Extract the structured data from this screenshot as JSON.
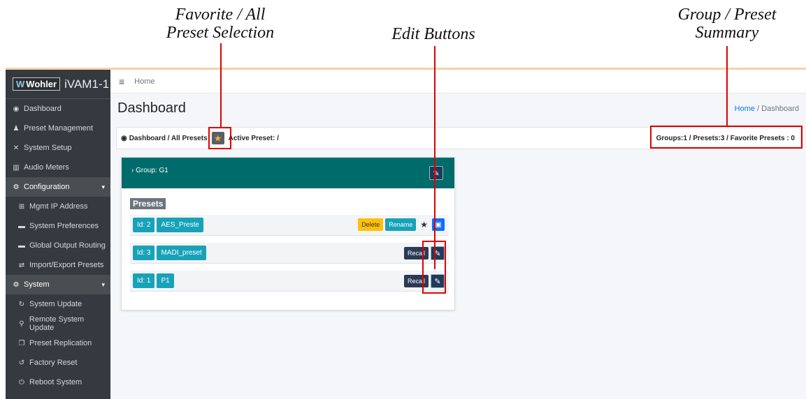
{
  "annotations": {
    "favorite_selection_line1": "Favorite / All",
    "favorite_selection_line2": "Preset Selection",
    "edit_buttons": "Edit Buttons",
    "summary_line1": "Group / Preset",
    "summary_line2": "Summary"
  },
  "brand": {
    "logo_text": "Wohler",
    "device": "iVAM1-1"
  },
  "sidebar": {
    "items": [
      {
        "label": "Dashboard",
        "icon": "dashboard-icon",
        "glyph": "◉"
      },
      {
        "label": "Preset Management",
        "icon": "user-gear-icon",
        "glyph": "♟"
      },
      {
        "label": "System Setup",
        "icon": "tools-icon",
        "glyph": "✕"
      },
      {
        "label": "Audio Meters",
        "icon": "chart-icon",
        "glyph": "▥"
      }
    ],
    "configuration": {
      "label": "Configuration",
      "items": [
        {
          "label": "Mgmt IP Address",
          "icon": "network-icon",
          "glyph": "⊞"
        },
        {
          "label": "System Preferences",
          "icon": "keyboard-icon",
          "glyph": "▬"
        },
        {
          "label": "Global Output Routing",
          "icon": "keyboard-icon",
          "glyph": "▬"
        },
        {
          "label": "Import/Export Presets",
          "icon": "exchange-icon",
          "glyph": "⇄"
        }
      ]
    },
    "system": {
      "label": "System",
      "items": [
        {
          "label": "System Update",
          "icon": "sync-icon",
          "glyph": "↻"
        },
        {
          "label": "Remote System Update",
          "icon": "satellite-icon",
          "glyph": "⚲"
        },
        {
          "label": "Preset Replication",
          "icon": "copy-icon",
          "glyph": "❐"
        },
        {
          "label": "Factory Reset",
          "icon": "undo-icon",
          "glyph": "↺"
        },
        {
          "label": "Reboot System",
          "icon": "power-icon",
          "glyph": "⏻"
        }
      ]
    }
  },
  "topbar": {
    "home": "Home"
  },
  "page": {
    "title": "Dashboard",
    "breadcrumb_home": "Home",
    "breadcrumb_sep": " / ",
    "breadcrumb_current": "Dashboard"
  },
  "filter": {
    "label": "Dashboard / All Presets",
    "active_preset": "Active Preset: /",
    "summary": "Groups:1 / Presets:3 / Favorite Presets : 0"
  },
  "group": {
    "label": "Group: G1",
    "presets_heading": "Presets",
    "rows": [
      {
        "id": "Id: 2",
        "name": "AES_Preste",
        "delete": "Delete",
        "rename": "Rename"
      },
      {
        "id": "Id: 3",
        "name": "MADI_preset",
        "recall": "Recall"
      },
      {
        "id": "Id: 1",
        "name": "P1",
        "recall": "Recall"
      }
    ]
  },
  "colors": {
    "accent_teal": "#006b6b",
    "chip": "#17a2b8",
    "annotation_red": "#e00000"
  }
}
